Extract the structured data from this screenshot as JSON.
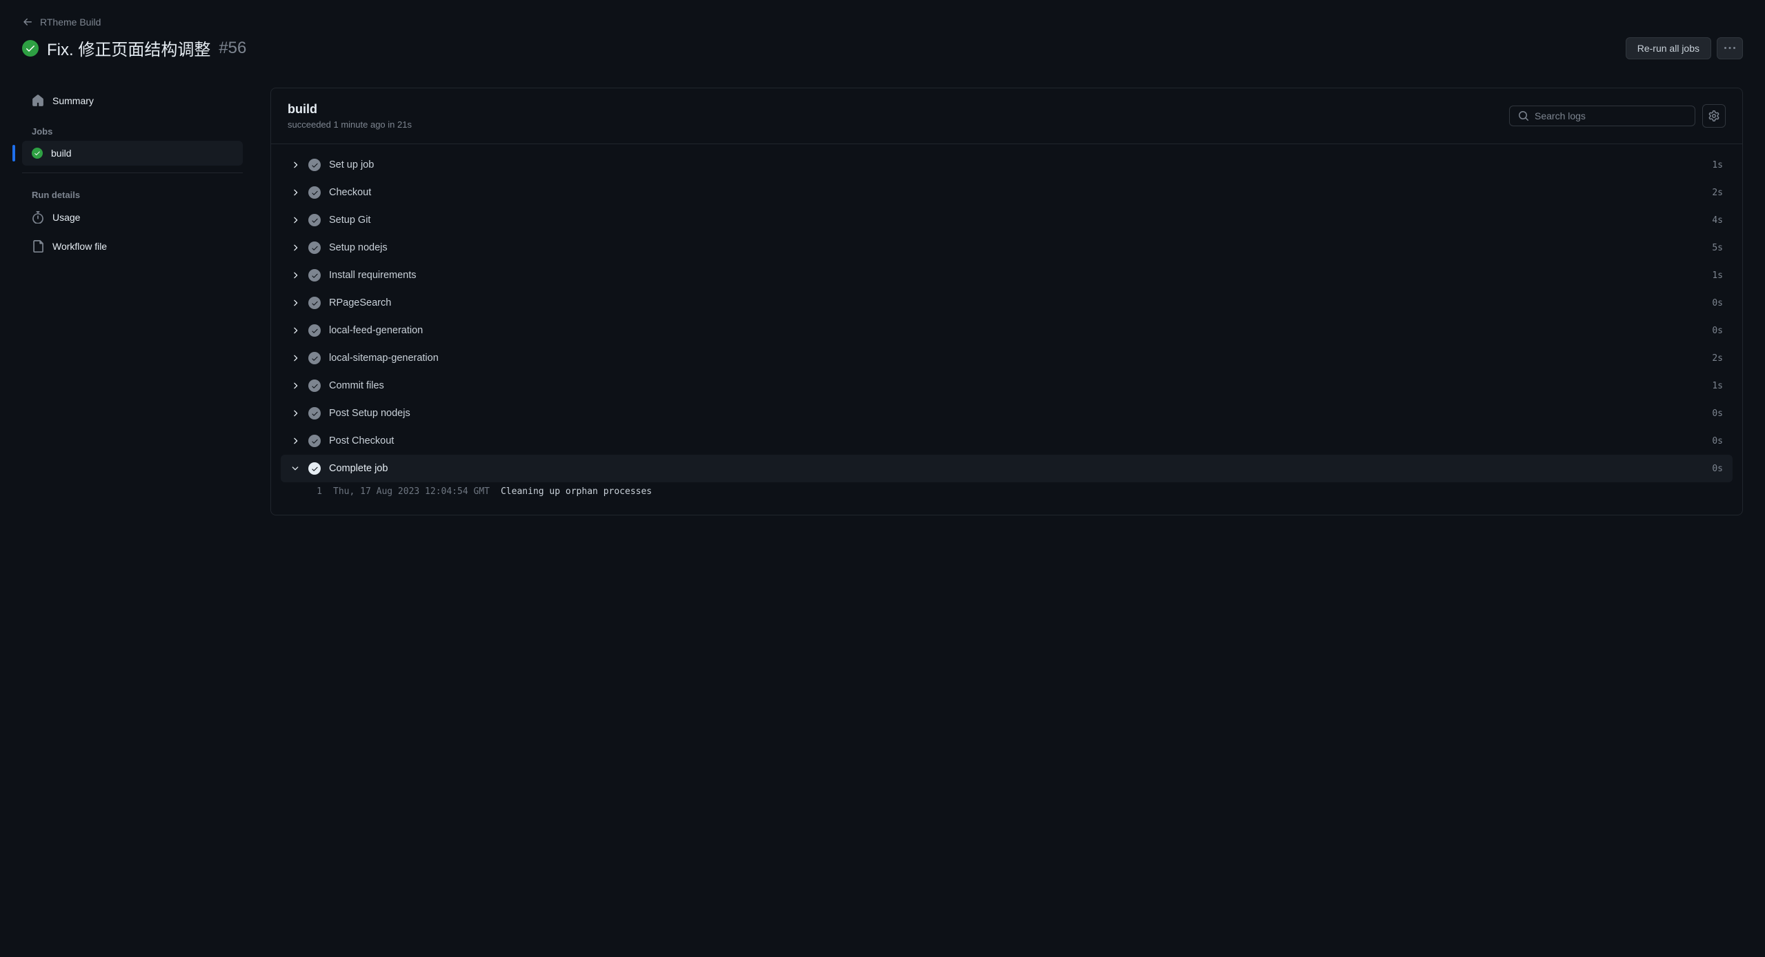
{
  "breadcrumb": {
    "back_label": "RTheme Build"
  },
  "title": {
    "text": "Fix. 修正页面结构调整",
    "run_number": "#56"
  },
  "actions": {
    "rerun_label": "Re-run all jobs"
  },
  "sidebar": {
    "summary_label": "Summary",
    "jobs_heading": "Jobs",
    "job_name": "build",
    "run_details_heading": "Run details",
    "usage_label": "Usage",
    "workflow_file_label": "Workflow file"
  },
  "job": {
    "name": "build",
    "meta": "succeeded 1 minute ago in 21s",
    "search_placeholder": "Search logs"
  },
  "steps": [
    {
      "name": "Set up job",
      "duration": "1s",
      "expanded": false
    },
    {
      "name": "Checkout",
      "duration": "2s",
      "expanded": false
    },
    {
      "name": "Setup Git",
      "duration": "4s",
      "expanded": false
    },
    {
      "name": "Setup nodejs",
      "duration": "5s",
      "expanded": false
    },
    {
      "name": "Install requirements",
      "duration": "1s",
      "expanded": false
    },
    {
      "name": "RPageSearch",
      "duration": "0s",
      "expanded": false
    },
    {
      "name": "local-feed-generation",
      "duration": "0s",
      "expanded": false
    },
    {
      "name": "local-sitemap-generation",
      "duration": "2s",
      "expanded": false
    },
    {
      "name": "Commit files",
      "duration": "1s",
      "expanded": false
    },
    {
      "name": "Post Setup nodejs",
      "duration": "0s",
      "expanded": false
    },
    {
      "name": "Post Checkout",
      "duration": "0s",
      "expanded": false
    },
    {
      "name": "Complete job",
      "duration": "0s",
      "expanded": true
    }
  ],
  "log": {
    "line_number": "1",
    "timestamp": "Thu, 17 Aug 2023 12:04:54 GMT",
    "message": "Cleaning up orphan processes"
  }
}
